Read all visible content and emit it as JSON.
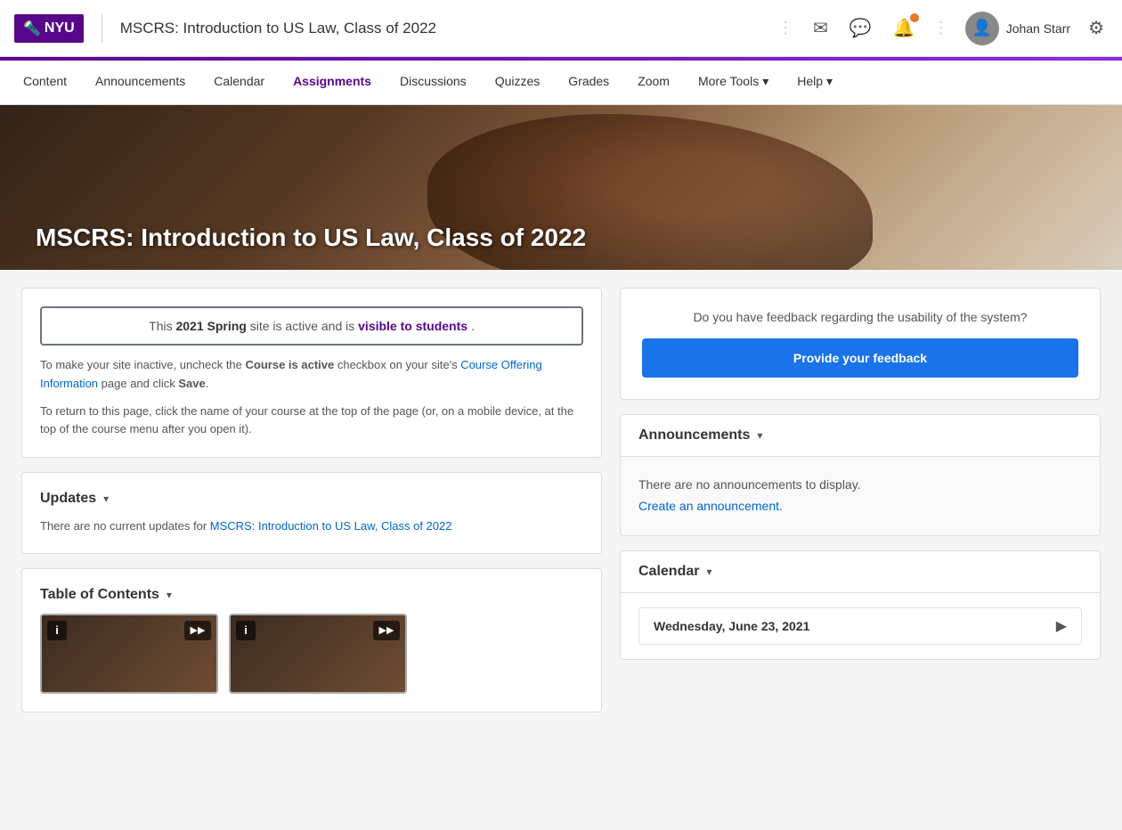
{
  "app": {
    "nyu_logo_text": "NYU",
    "course_title": "MSCRS: Introduction to US Law, Class of 2022"
  },
  "nav": {
    "items": [
      {
        "label": "Content",
        "active": false
      },
      {
        "label": "Announcements",
        "active": false
      },
      {
        "label": "Calendar",
        "active": false
      },
      {
        "label": "Assignments",
        "active": false,
        "highlight": true
      },
      {
        "label": "Discussions",
        "active": false
      },
      {
        "label": "Quizzes",
        "active": false
      },
      {
        "label": "Grades",
        "active": false
      },
      {
        "label": "Zoom",
        "active": false
      },
      {
        "label": "More Tools",
        "active": false,
        "dropdown": true
      },
      {
        "label": "Help",
        "active": false,
        "dropdown": true
      }
    ]
  },
  "hero": {
    "title": "MSCRS: Introduction to US Law, Class of 2022"
  },
  "visibility_notice": {
    "prefix": "This",
    "semester": "2021 Spring",
    "middle": "site is active and is",
    "visible_text": "visible to students",
    "suffix": "."
  },
  "info_paragraphs": {
    "p1_prefix": "To make your site inactive, uncheck the",
    "p1_bold": "Course is active",
    "p1_middle": "checkbox on your site's",
    "p1_link": "Course Offering Information",
    "p1_suffix": "page and click",
    "p1_save": "Save",
    "p1_end": ".",
    "p2": "To return to this page, click the name of your course at the top of the page (or, on a mobile device, at the top of the course menu after you open it)."
  },
  "updates": {
    "section_title": "Updates",
    "text_prefix": "There are no current updates for",
    "link_text": "MSCRS: Introduction to US Law, Class of 2022",
    "text_suffix": ""
  },
  "table_of_contents": {
    "section_title": "Table of Contents"
  },
  "feedback": {
    "question": "Do you have feedback regarding the usability of the system?",
    "button_label": "Provide your feedback"
  },
  "announcements": {
    "section_title": "Announcements",
    "no_announcements_text": "There are no announcements to display.",
    "create_link_text": "Create an announcement."
  },
  "calendar": {
    "section_title": "Calendar",
    "date_text": "Wednesday, June 23, 2021"
  },
  "user": {
    "name": "Johan Starr"
  },
  "icons": {
    "grid": "⊞",
    "mail": "✉",
    "chat": "💬",
    "bell": "🔔",
    "gear": "⚙",
    "chevron_down": "▾",
    "chevron_right": "▶",
    "info": "i",
    "play": "▶▶"
  }
}
